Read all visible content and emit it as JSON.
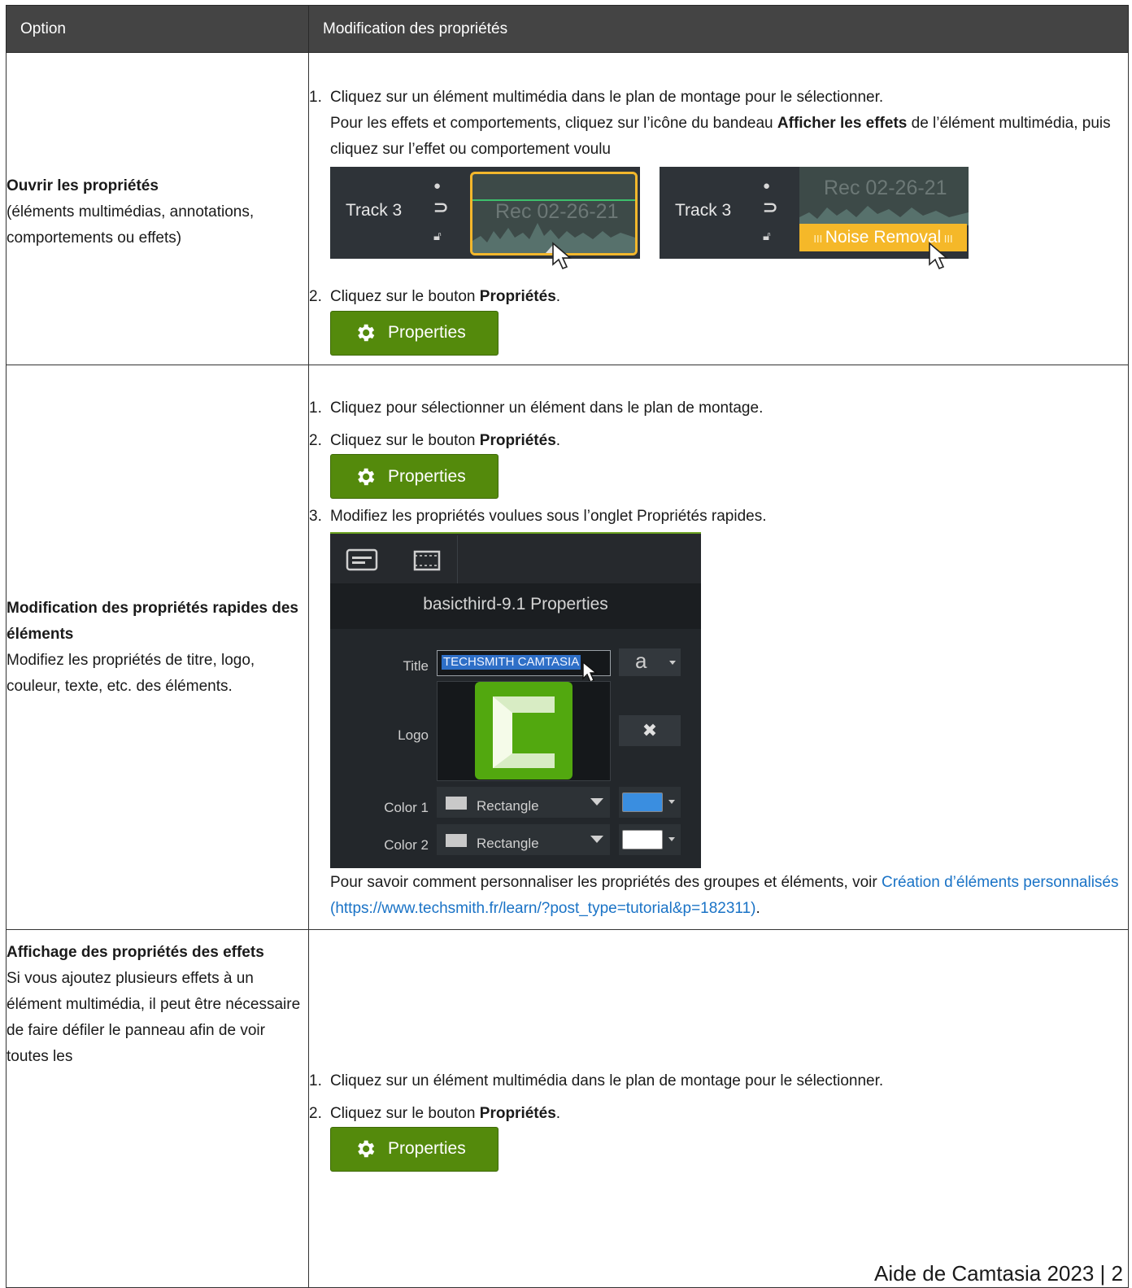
{
  "table": {
    "header": {
      "option": "Option",
      "modification": "Modification des propriétés"
    },
    "rows": [
      {
        "option_title": "Ouvrir les propriétés",
        "option_desc": "(éléments multimédias, annotations, comportements ou effets)",
        "step1_num": "1.",
        "step1_text": "Cliquez sur un élément multimédia dans le plan de montage pour le sélectionner.",
        "step1_sub_before": "Pour les effets et comportements, cliquez sur l’icône du bandeau ",
        "step1_sub_bold": "Afficher les effets",
        "step1_sub_after": " de l’élément multimédia, puis cliquez sur l’effet ou comportement voulu",
        "track_label": "Track 3",
        "clip_text": "Rec 02-26-21",
        "noise_label": "Noise Removal",
        "step2_num": "2.",
        "step2_before": "Cliquez sur le bouton ",
        "step2_bold": "Propriétés",
        "step2_after": "."
      },
      {
        "option_title": "Modification des propriétés rapides des éléments",
        "option_desc": "Modifiez les propriétés de titre, logo, couleur, texte, etc. des éléments.",
        "step1_num": "1.",
        "step1_text": "Cliquez pour sélectionner un élément dans le plan de montage.",
        "step2_num": "2.",
        "step2_before": "Cliquez sur le bouton ",
        "step2_bold": "Propriétés",
        "step2_after": ".",
        "step3_num": "3.",
        "step3_text": "Modifiez les propriétés voulues sous l’onglet Propriétés rapides.",
        "panel": {
          "title": "basicthird-9.1 Properties",
          "title_label": "Title",
          "title_value": "TECHSMITH CAMTASIA",
          "font_glyph": "a",
          "logo_label": "Logo",
          "color1_label": "Color 1",
          "color2_label": "Color 2",
          "shape1": "Rectangle",
          "shape2": "Rectangle",
          "color1": "#3a8ee0",
          "color2": "#ffffff",
          "clear_icon": "close-icon"
        },
        "note_text": "Pour savoir comment personnaliser les propriétés des groupes et éléments, voir ",
        "note_link": "Création d’éléments personnalisés (https://www.techsmith.fr/learn/?post_type=tutorial&p=182311)",
        "note_end": "."
      },
      {
        "option_title": "Affichage des propriétés des effets",
        "option_desc": "Si vous ajoutez plusieurs effets à un élément multimédia, il peut être nécessaire de faire défiler le panneau afin de voir toutes les",
        "step1_num": "1.",
        "step1_text": "Cliquez sur un élément multimédia dans le plan de montage pour le sélectionner.",
        "step2_num": "2.",
        "step2_before": "Cliquez sur le bouton ",
        "step2_bold": "Propriétés",
        "step2_after": "."
      }
    ]
  },
  "properties_button": {
    "label": "Properties",
    "icon": "gear-icon",
    "color": "#548a0c"
  },
  "footer": {
    "text": "Aide de Camtasia 2023 | 2"
  }
}
